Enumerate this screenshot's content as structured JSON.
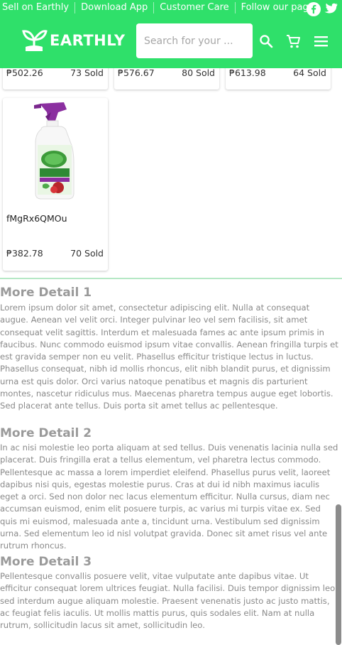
{
  "topbar": {
    "links": [
      "Sell on Earthly",
      "Download App",
      "Customer Care",
      "Follow our page"
    ],
    "social_icons": [
      "facebook-icon",
      "twitter-icon"
    ]
  },
  "header": {
    "logo_text": "EARTHLY",
    "search_placeholder": "Search for your ...",
    "icons": [
      "search-icon",
      "cart-icon",
      "menu-icon"
    ]
  },
  "products": [
    {
      "price": "₱502.26",
      "sold": "73 Sold"
    },
    {
      "price": "₱576.67",
      "sold": "80 Sold"
    },
    {
      "price": "₱613.98",
      "sold": "64 Sold"
    },
    {
      "name": "fMgRx6QMOu",
      "price": "₱382.78",
      "sold": "70 Sold"
    }
  ],
  "details": [
    {
      "title": "More Detail 1",
      "body": "Lorem ipsum dolor sit amet, consectetur adipiscing elit. Nulla at consequat augue. Aenean vel velit orci. Integer pulvinar leo vel sem facilisis, sit amet consequat velit sagittis. Interdum et malesuada fames ac ante ipsum primis in faucibus. Nunc commodo euismod ipsum vitae convallis. Aenean fringilla turpis et est gravida semper non eu velit. Phasellus efficitur tristique lectus in luctus. Phasellus consequat, nibh id mollis rhoncus, elit nibh blandit purus, et dignissim urna est quis dolor. Orci varius natoque penatibus et magnis dis parturient montes, nascetur ridiculus mus. Maecenas pharetra tempus augue eget lobortis. Sed placerat ante tellus. Duis porta sit amet tellus ac pellentesque."
    },
    {
      "title": "More Detail 2",
      "body": "In ac nisi molestie leo porta aliquam at sed tellus. Duis venenatis lacinia nulla sed placerat. Duis fringilla erat a tellus elementum, vel pharetra lectus commodo. Pellentesque ac massa a lorem imperdiet eleifend. Phasellus purus velit, laoreet dapibus nisi quis, egestas molestie purus. Cras at dui id nibh maximus iaculis eget a orci. Sed non dolor nec lacus elementum efficitur. Nulla cursus, diam nec accumsan euismod, enim elit posuere turpis, ac varius mi turpis vitae ex. Sed quis mi euismod, malesuada ante a, tincidunt urna. Vestibulum sed dignissim urna. Sed elementum leo id nisl volutpat gravida. Donec sit amet risus vel ante rutrum rhoncus."
    },
    {
      "title": "More Detail 3",
      "body": "Pellentesque convallis posuere velit, vitae vulputate ante dapibus vitae. Ut efficitur consequat lorem ultrices feugiat. Nulla facilisi. Duis tempor dignissim leo, sed interdum augue aliquam molestie. Praesent venenatis justo ac justo mattis, ac feugiat felis iaculis. Ut mollis mattis purus, quis sodales elit. Nam at nulla rutrum, sollicitudin lacus sit amet, sollicitudin leo."
    }
  ],
  "colors": {
    "brand_green": "#2fe06a",
    "divider": "#b5e8c5",
    "section_title": "#9a9a9a",
    "section_body": "#8a8a8a"
  }
}
